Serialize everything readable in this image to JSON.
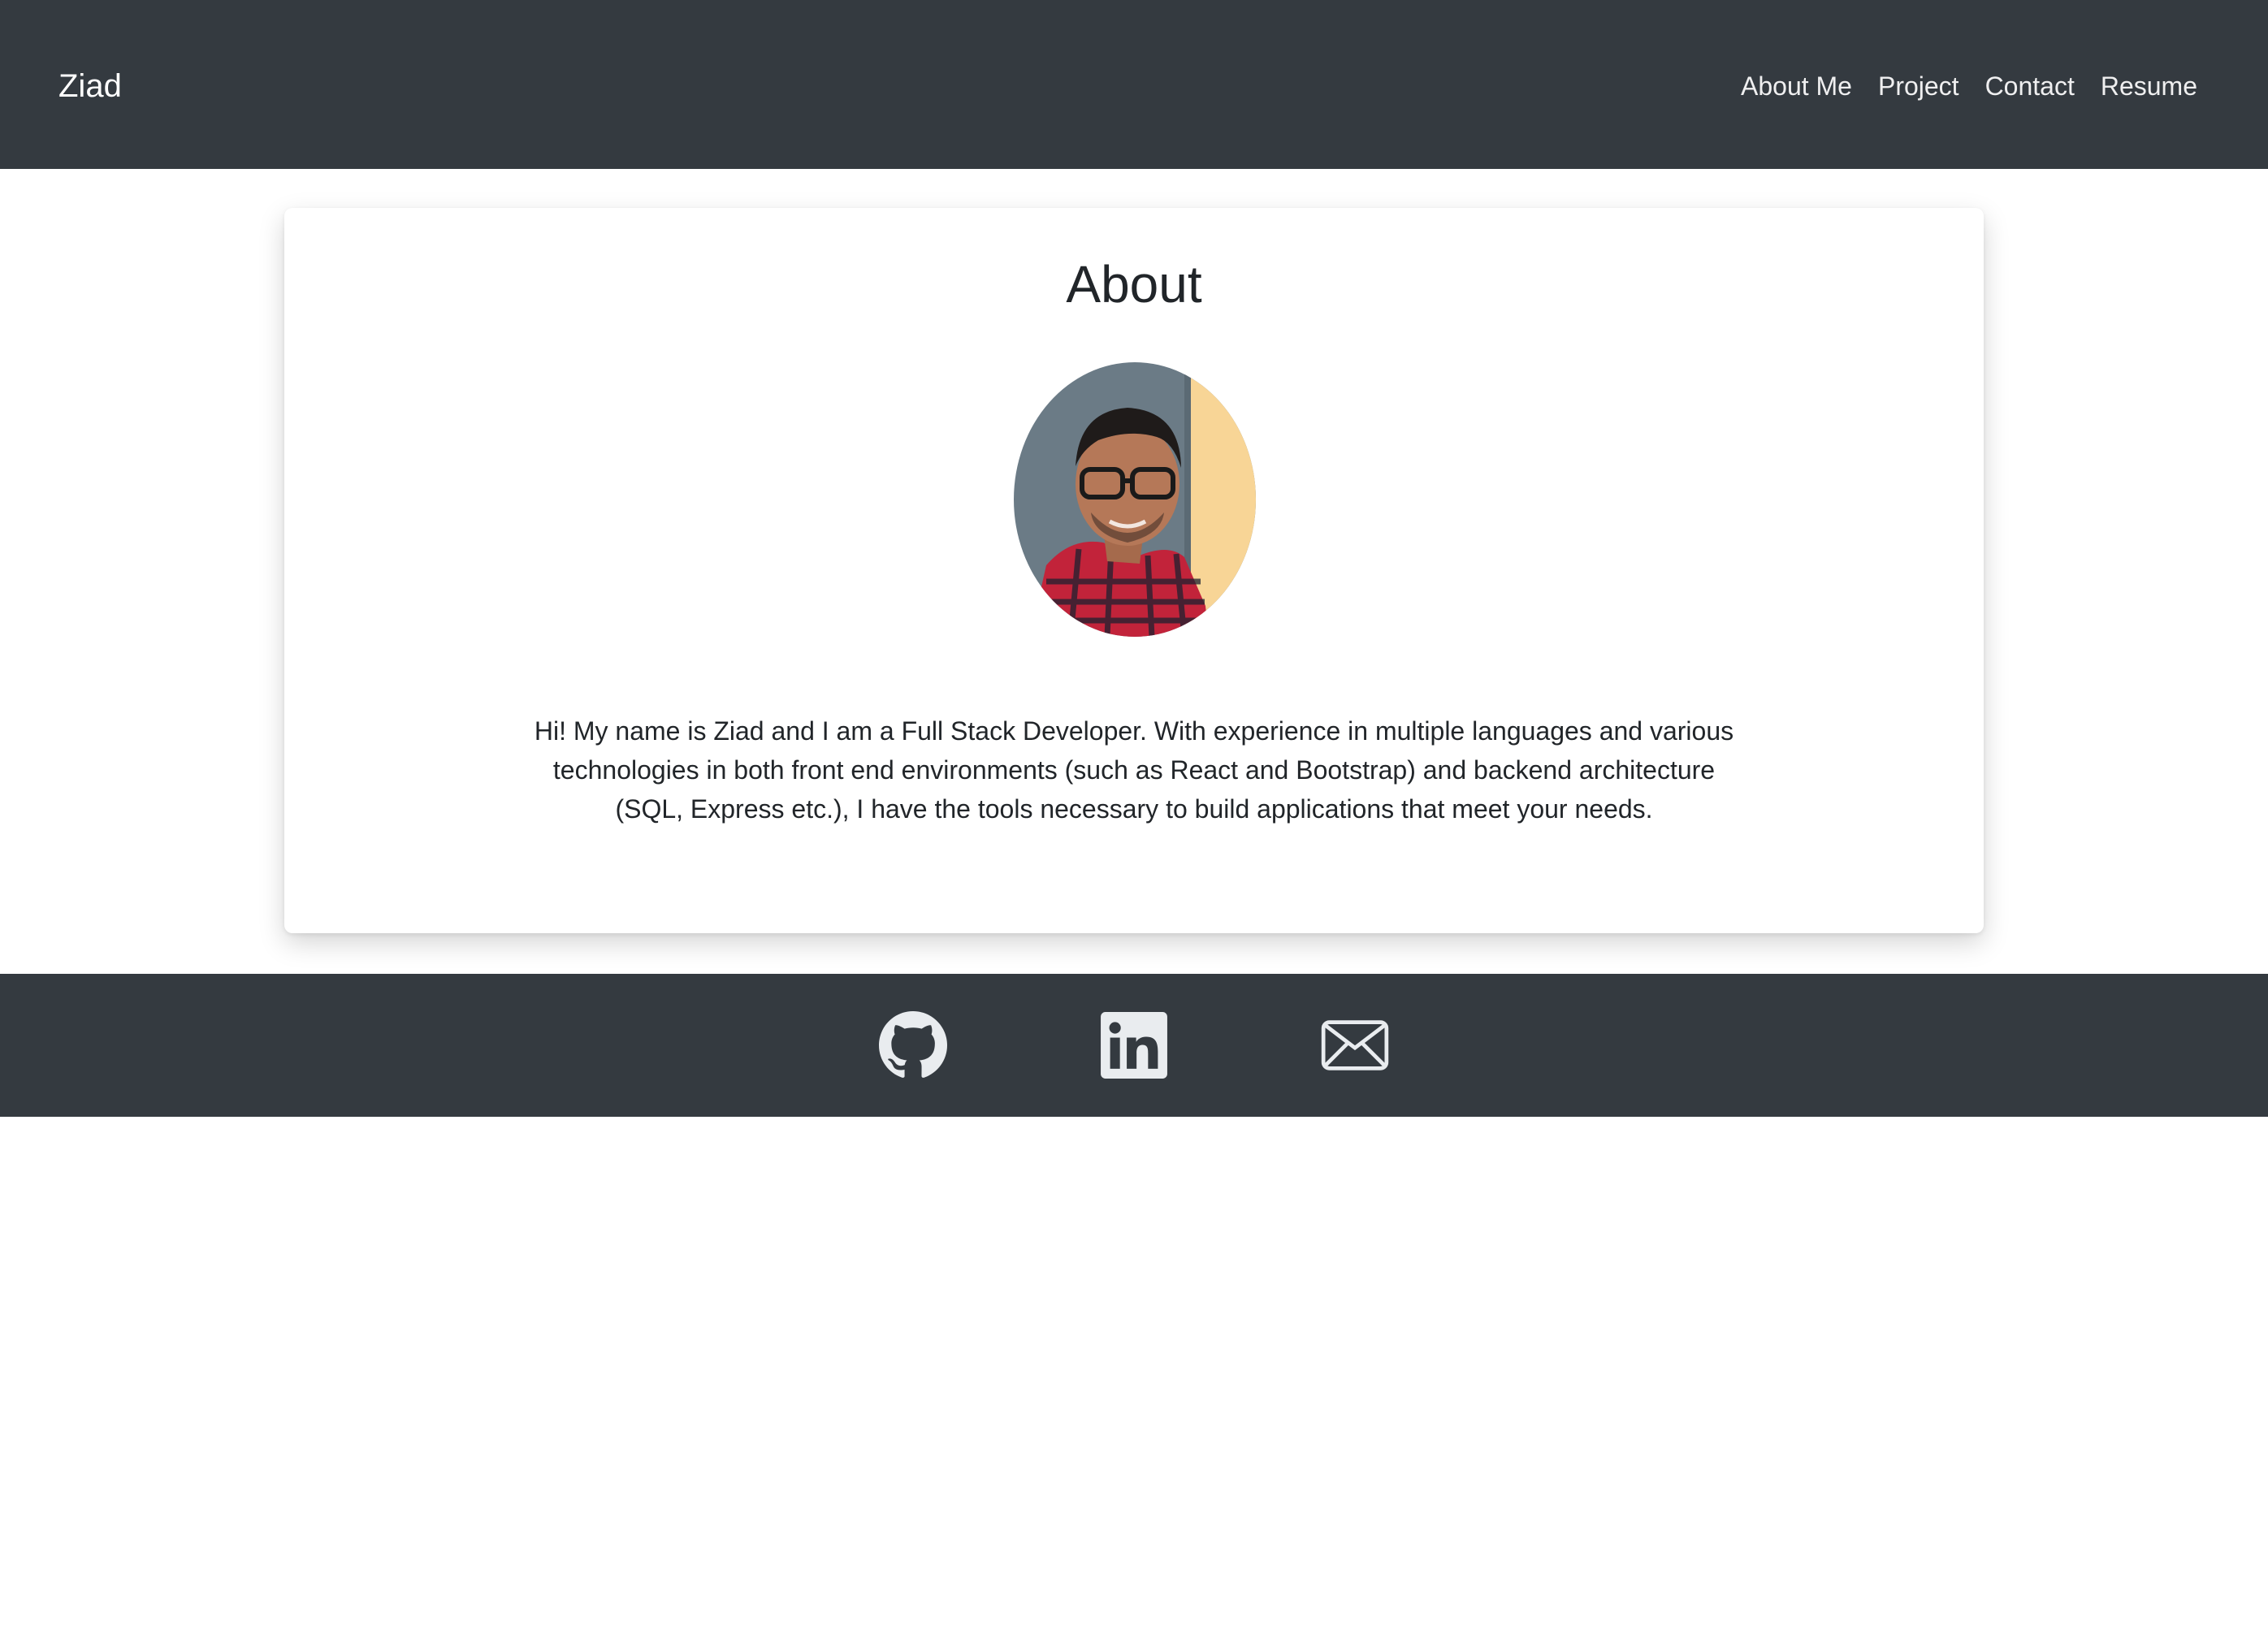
{
  "navbar": {
    "brand": "Ziad",
    "links": [
      {
        "label": "About Me"
      },
      {
        "label": "Project"
      },
      {
        "label": "Contact"
      },
      {
        "label": "Resume"
      }
    ]
  },
  "about": {
    "title": "About",
    "bio": "Hi! My name is Ziad and I am a Full Stack Developer. With experience in multiple languages and various technologies in both front end environments (such as React and Bootstrap) and backend architecture (SQL, Express etc.), I have the tools necessary to build applications that meet your needs."
  },
  "footer": {
    "icons": [
      "github-icon",
      "linkedin-icon",
      "envelope-icon"
    ]
  },
  "colors": {
    "navbar_bg": "#343a40",
    "footer_bg": "#343a40",
    "icon": "#e9ecef"
  }
}
